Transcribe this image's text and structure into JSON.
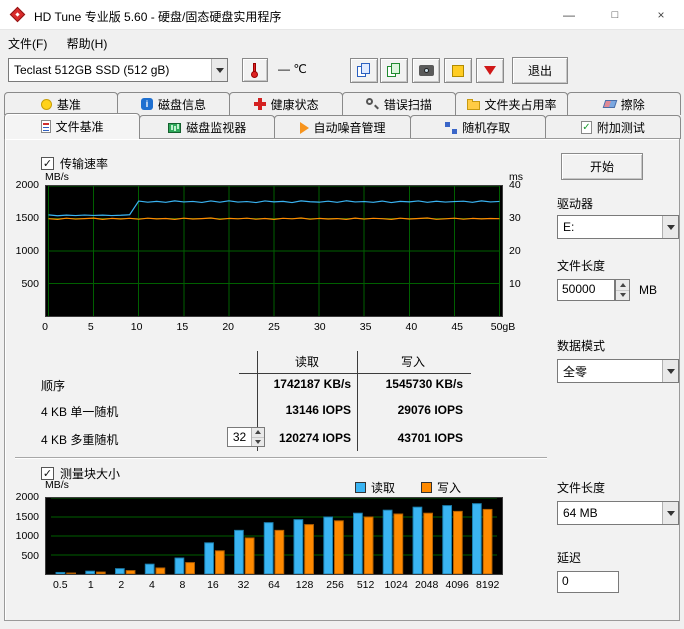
{
  "window": {
    "title": "HD Tune 专业版 5.60 - 硬盘/固态硬盘实用程序",
    "minimize": "—",
    "maximize": "□",
    "close": "×"
  },
  "menu": {
    "items": [
      {
        "label": "文件(F)"
      },
      {
        "label": "帮助(H)"
      }
    ]
  },
  "toolbar": {
    "drive_select": "Teclast 512GB SSD (512 gB)",
    "temperature": "—",
    "temp_unit": "℃",
    "exit": "退出"
  },
  "tabs": {
    "row1": [
      {
        "label": "基准"
      },
      {
        "label": "磁盘信息"
      },
      {
        "label": "健康状态"
      },
      {
        "label": "错误扫描"
      },
      {
        "label": "文件夹占用率"
      },
      {
        "label": "擦除"
      }
    ],
    "row2": [
      {
        "label": "文件基准"
      },
      {
        "label": "磁盘监视器"
      },
      {
        "label": "自动噪音管理"
      },
      {
        "label": "随机存取"
      },
      {
        "label": "附加测试"
      }
    ]
  },
  "file_benchmark": {
    "transfer_rate_label": "传输速率",
    "block_size_label": "测量块大小",
    "checkmark": "✓",
    "results": {
      "read_header": "读取",
      "write_header": "写入",
      "rows": [
        {
          "label": "顺序",
          "read": "1742187 KB/s",
          "write": "1545730 KB/s"
        },
        {
          "label": "4 KB 单一随机",
          "read": "13146 IOPS",
          "write": "29076 IOPS"
        },
        {
          "label": "4 KB 多重随机",
          "queue_depth": "32",
          "read": "120274 IOPS",
          "write": "43701 IOPS"
        }
      ]
    }
  },
  "panel": {
    "start": "开始",
    "drive_label": "驱动器",
    "drive_value": "E:",
    "file_length_label": "文件长度",
    "file_length_value": "50000",
    "file_length_unit": "MB",
    "data_mode_label": "数据模式",
    "data_mode_value": "全零",
    "block_file_length_label": "文件长度",
    "block_file_length_value": "64 MB",
    "delay_label": "延迟",
    "delay_value": "0"
  },
  "chart_data": [
    {
      "type": "line",
      "title": "传输速率",
      "ylabel": "MB/s",
      "y2label": "ms",
      "ylim": [
        0,
        2000
      ],
      "y2lim": [
        0,
        40
      ],
      "xlim": [
        0,
        50
      ],
      "yticks": [
        500,
        1000,
        1500,
        2000
      ],
      "y2ticks": [
        10,
        20,
        30,
        40
      ],
      "xticks": [
        "0",
        "5",
        "10",
        "15",
        "20",
        "25",
        "30",
        "35",
        "40",
        "45",
        "50gB"
      ],
      "xtick_values": [
        0,
        5,
        10,
        15,
        20,
        25,
        30,
        35,
        40,
        45,
        50
      ],
      "grid": true,
      "grid_color": "#005f00",
      "bg": "#000000",
      "series": [
        {
          "name": "读取",
          "color": "#3ab4f2",
          "x": [
            0,
            1,
            2,
            3,
            4,
            5,
            6,
            7,
            8,
            9,
            10,
            11,
            12,
            13,
            14,
            15,
            16,
            17,
            18,
            19,
            20,
            21,
            22,
            23,
            24,
            25,
            26,
            27,
            28,
            29,
            30,
            31,
            32,
            33,
            34,
            35,
            36,
            37,
            38,
            39,
            40,
            41,
            42,
            43,
            44,
            45,
            46,
            47,
            48,
            49,
            50
          ],
          "y": [
            1556,
            1543,
            1551,
            1546,
            1553,
            1547,
            1552,
            1545,
            1550,
            1558,
            1768,
            1752,
            1764,
            1748,
            1771,
            1755,
            1762,
            1747,
            1769,
            1751,
            1773,
            1753,
            1760,
            1746,
            1770,
            1756,
            1764,
            1745,
            1771,
            1757,
            1751,
            1766,
            1748,
            1772,
            1754,
            1761,
            1749,
            1768,
            1746,
            1763,
            1756,
            1770,
            1748,
            1765,
            1753,
            1760,
            1767,
            1749,
            1771,
            1755,
            1762
          ]
        },
        {
          "name": "写入",
          "color": "#ff8a00",
          "x": [
            0,
            1,
            2,
            3,
            4,
            5,
            6,
            7,
            8,
            9,
            10,
            11,
            12,
            13,
            14,
            15,
            16,
            17,
            18,
            19,
            20,
            21,
            22,
            23,
            24,
            25,
            26,
            27,
            28,
            29,
            30,
            31,
            32,
            33,
            34,
            35,
            36,
            37,
            38,
            39,
            40,
            41,
            42,
            43,
            44,
            45,
            46,
            47,
            48,
            49,
            50
          ],
          "y": [
            1497,
            1487,
            1504,
            1491,
            1499,
            1506,
            1486,
            1501,
            1493,
            1503,
            1489,
            1505,
            1494,
            1500,
            1487,
            1504,
            1492,
            1498,
            1507,
            1488,
            1502,
            1495,
            1505,
            1490,
            1500,
            1486,
            1503,
            1496,
            1507,
            1489,
            1501,
            1493,
            1499,
            1487,
            1506,
            1491,
            1503,
            1497,
            1486,
            1505,
            1492,
            1500,
            1507,
            1488,
            1496,
            1504,
            1490,
            1502,
            1494,
            1500,
            1497
          ]
        }
      ]
    },
    {
      "type": "bar",
      "title": "测量块大小",
      "ylabel": "MB/s",
      "ylim": [
        0,
        2000
      ],
      "yticks": [
        500,
        1000,
        1500,
        2000
      ],
      "categories": [
        "0.5",
        "1",
        "2",
        "4",
        "8",
        "16",
        "32",
        "64",
        "128",
        "256",
        "512",
        "1024",
        "2048",
        "4096",
        "8192"
      ],
      "grid": true,
      "grid_color": "#005f00",
      "bg": "#000000",
      "legend_position": "top-right",
      "series": [
        {
          "name": "读取",
          "color": "#3ab4f2",
          "edge": "#1a7fae",
          "values": [
            40,
            75,
            140,
            260,
            420,
            820,
            1150,
            1350,
            1430,
            1500,
            1600,
            1680,
            1760,
            1800,
            1850
          ]
        },
        {
          "name": "写入",
          "color": "#ff8a00",
          "edge": "#b35f00",
          "values": [
            25,
            50,
            90,
            160,
            300,
            610,
            950,
            1150,
            1300,
            1400,
            1500,
            1580,
            1600,
            1650,
            1700
          ]
        }
      ]
    }
  ]
}
